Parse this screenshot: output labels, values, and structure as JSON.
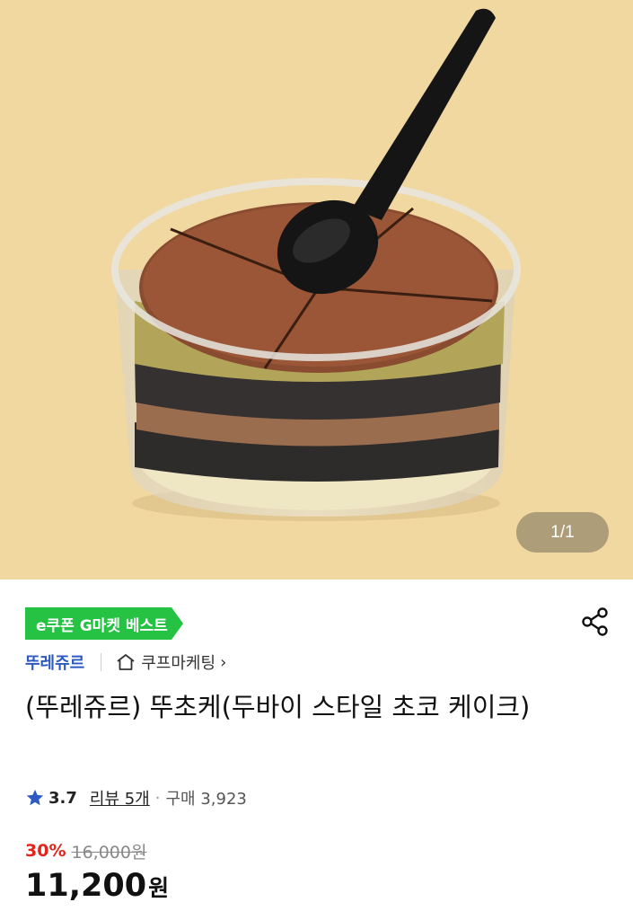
{
  "gallery": {
    "indicator": "1/1",
    "background_color": "#f0d8a0"
  },
  "badge": {
    "label": "e쿠폰 G마켓 베스트",
    "color": "#25c244"
  },
  "share_icon": "share-icon",
  "seller": {
    "brand": "뚜레쥬르",
    "shop": "쿠프마케팅",
    "shop_chevron": "›",
    "brand_color": "#2d59c2"
  },
  "product": {
    "title": "(뚜레쥬르) 뚜초케(두바이 스타일 초코 케이크)"
  },
  "rating": {
    "score": "3.7",
    "review_label": "리뷰 5개",
    "separator": "·",
    "purchase_label": "구매 3,923",
    "star_color": "#2d59c2"
  },
  "pricing": {
    "discount": "30%",
    "original": "16,000원",
    "price": "11,200",
    "currency": "원",
    "discount_color": "#e1241c"
  }
}
